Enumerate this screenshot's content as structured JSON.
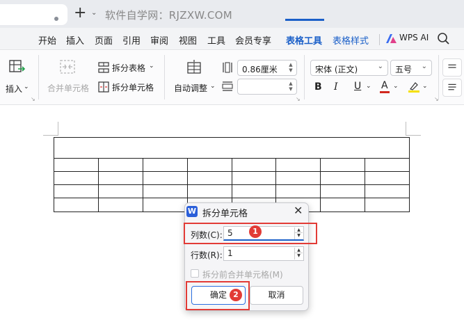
{
  "topbar": {
    "site_text": "软件自学网：RJZXW.COM",
    "new_tab": "+"
  },
  "menu": {
    "items": [
      "开始",
      "插入",
      "页面",
      "引用",
      "审阅",
      "视图",
      "工具",
      "会员专享",
      "表格工具",
      "表格样式"
    ],
    "active": "表格工具",
    "wps_ai": "WPS AI"
  },
  "ribbon": {
    "insert": "插入",
    "merge_cells": "合并单元格",
    "split_table": "拆分表格",
    "split_cells": "拆分单元格",
    "autofit": "自动调整",
    "width_value": "0.86厘米",
    "height_value": "",
    "font_name": "宋体 (正文)",
    "font_size": "五号",
    "bold": "B",
    "italic": "I",
    "underline": "U",
    "font_color": "A"
  },
  "dialog": {
    "logo": "W",
    "title": "拆分单元格",
    "columns_label": "列数(C):",
    "columns_value": "5",
    "rows_label": "行数(R):",
    "rows_value": "1",
    "merge_before_split_label": "拆分前合并单元格(M)",
    "merge_before_split_checked": false,
    "ok_label": "确定",
    "cancel_label": "取消"
  },
  "annotations": {
    "badge_1": "1",
    "badge_2": "2"
  },
  "colors": {
    "accent": "#1a5fc8",
    "highlight": "#e23b36"
  }
}
